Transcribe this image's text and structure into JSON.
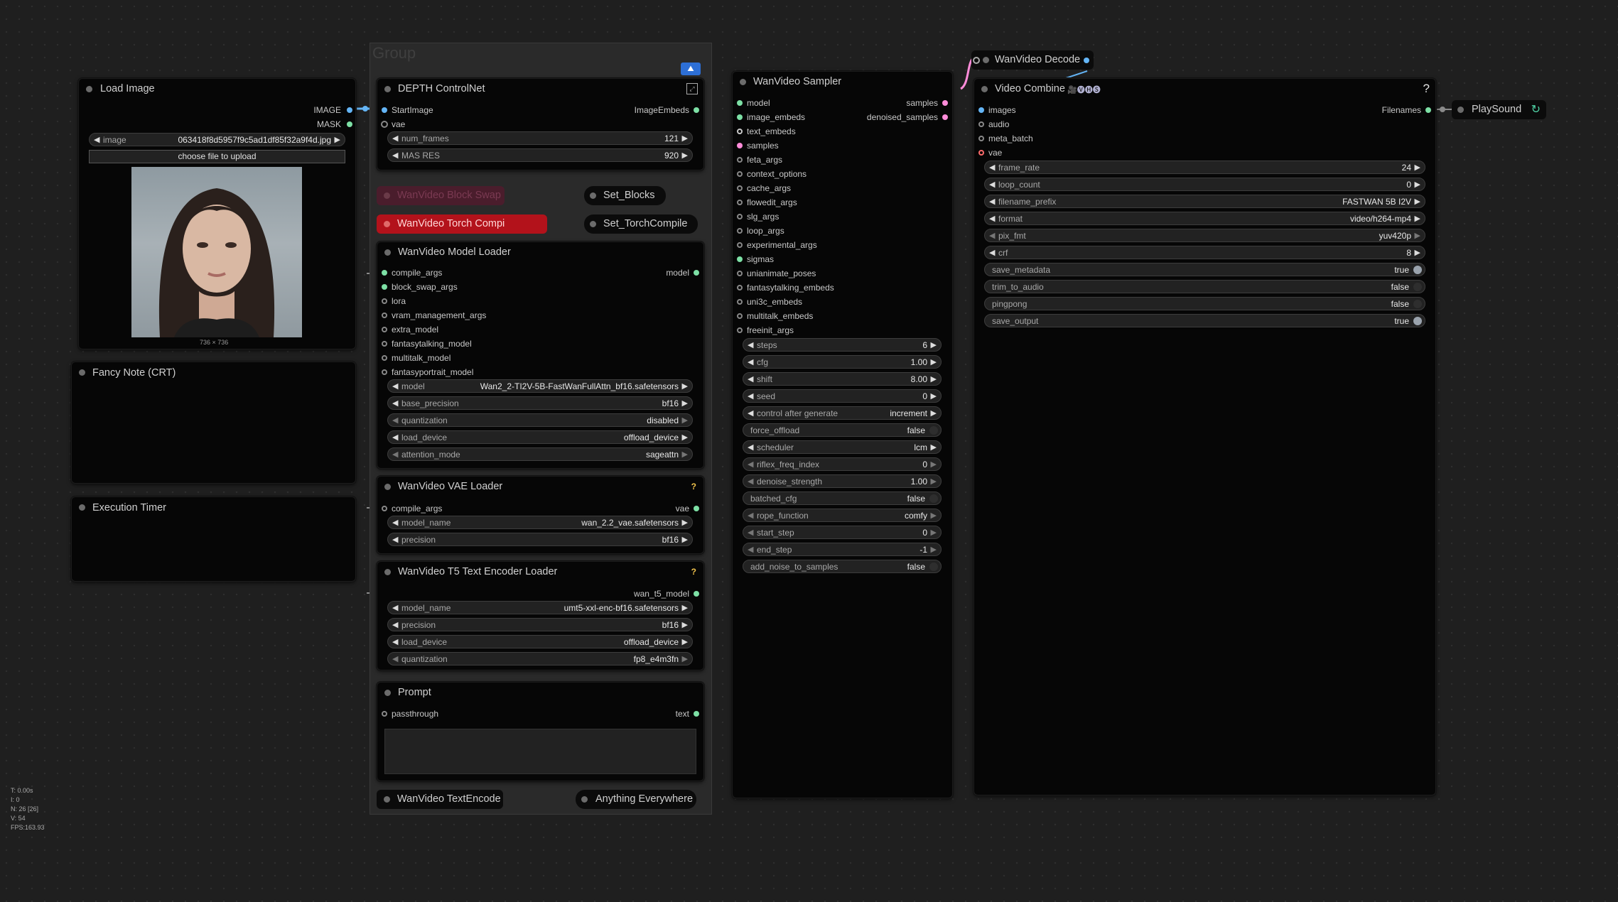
{
  "group": {
    "title": "Group"
  },
  "load_image": {
    "title": "Load Image",
    "outputs": [
      "IMAGE",
      "MASK"
    ],
    "image_widget": {
      "name": "image",
      "value": "063418f8d5957f9c5ad1df85f32a9f4d.jpg"
    },
    "upload_button": "choose file to upload",
    "dimensions": "736 × 736"
  },
  "fancy_note": {
    "title": "Fancy Note (CRT)"
  },
  "execution_timer": {
    "title": "Execution Timer"
  },
  "depth_controlnet": {
    "title": "DEPTH ControlNet",
    "inputs": [
      "StartImage",
      "vae"
    ],
    "output": "ImageEmbeds",
    "widgets": [
      {
        "name": "num_frames",
        "value": "121"
      },
      {
        "name": "MAS RES",
        "value": "920"
      }
    ]
  },
  "block_swap": {
    "title": "WanVideo Block Swap",
    "set_label": "Set_Blocks"
  },
  "torch_compile": {
    "title": "WanVideo Torch Compi",
    "set_label": "Set_TorchCompile"
  },
  "model_loader": {
    "title": "WanVideo Model Loader",
    "inputs": [
      "compile_args",
      "block_swap_args",
      "lora",
      "vram_management_args",
      "extra_model",
      "fantasytalking_model",
      "multitalk_model",
      "fantasyportrait_model"
    ],
    "output": "model",
    "widgets": [
      {
        "name": "model",
        "value": "Wan2_2-TI2V-5B-FastWanFullAttn_bf16.safetensors"
      },
      {
        "name": "base_precision",
        "value": "bf16"
      },
      {
        "name": "quantization",
        "value": "disabled"
      },
      {
        "name": "load_device",
        "value": "offload_device"
      },
      {
        "name": "attention_mode",
        "value": "sageattn"
      }
    ]
  },
  "vae_loader": {
    "title": "WanVideo VAE Loader",
    "help": "?",
    "input": "compile_args",
    "output": "vae",
    "widgets": [
      {
        "name": "model_name",
        "value": "wan_2.2_vae.safetensors"
      },
      {
        "name": "precision",
        "value": "bf16"
      }
    ]
  },
  "t5_loader": {
    "title": "WanVideo T5 Text Encoder Loader",
    "help": "?",
    "output": "wan_t5_model",
    "widgets": [
      {
        "name": "model_name",
        "value": "umt5-xxl-enc-bf16.safetensors"
      },
      {
        "name": "precision",
        "value": "bf16"
      },
      {
        "name": "load_device",
        "value": "offload_device"
      },
      {
        "name": "quantization",
        "value": "fp8_e4m3fn"
      }
    ]
  },
  "prompt": {
    "title": "Prompt",
    "input": "passthrough",
    "output": "text",
    "text": ""
  },
  "text_encode": {
    "title": "WanVideo TextEncode",
    "anything": "Anything Everywhere"
  },
  "sampler": {
    "title": "WanVideo Sampler",
    "inputs": [
      "model",
      "image_embeds",
      "text_embeds",
      "samples",
      "feta_args",
      "context_options",
      "cache_args",
      "flowedit_args",
      "slg_args",
      "loop_args",
      "experimental_args",
      "sigmas",
      "unianimate_poses",
      "fantasytalking_embeds",
      "uni3c_embeds",
      "multitalk_embeds",
      "freeinit_args"
    ],
    "outputs": [
      "samples",
      "denoised_samples"
    ],
    "widgets": [
      {
        "name": "steps",
        "value": "6"
      },
      {
        "name": "cfg",
        "value": "1.00"
      },
      {
        "name": "shift",
        "value": "8.00"
      },
      {
        "name": "seed",
        "value": "0"
      },
      {
        "name": "control after generate",
        "value": "increment"
      },
      {
        "name": "force_offload",
        "value": "false"
      },
      {
        "name": "scheduler",
        "value": "lcm"
      },
      {
        "name": "riflex_freq_index",
        "value": "0"
      },
      {
        "name": "denoise_strength",
        "value": "1.00"
      },
      {
        "name": "batched_cfg",
        "value": "false"
      },
      {
        "name": "rope_function",
        "value": "comfy"
      },
      {
        "name": "start_step",
        "value": "0"
      },
      {
        "name": "end_step",
        "value": "-1"
      },
      {
        "name": "add_noise_to_samples",
        "value": "false"
      }
    ]
  },
  "decode": {
    "title": "WanVideo Decode"
  },
  "video_combine": {
    "title": "Video Combine",
    "title_icons": "🎥🅥🅗🅢",
    "help": "?",
    "inputs": [
      "images",
      "audio",
      "meta_batch",
      "vae"
    ],
    "output": "Filenames",
    "widgets": [
      {
        "name": "frame_rate",
        "value": "24"
      },
      {
        "name": "loop_count",
        "value": "0"
      },
      {
        "name": "filename_prefix",
        "value": "FASTWAN 5B I2V"
      },
      {
        "name": "format",
        "value": "video/h264-mp4"
      },
      {
        "name": "pix_fmt",
        "value": "yuv420p"
      },
      {
        "name": "crf",
        "value": "8"
      },
      {
        "name": "save_metadata",
        "value": "true"
      },
      {
        "name": "trim_to_audio",
        "value": "false"
      },
      {
        "name": "pingpong",
        "value": "false"
      },
      {
        "name": "save_output",
        "value": "true"
      }
    ]
  },
  "play_sound": {
    "title": "PlaySound"
  },
  "stats": {
    "lines": [
      "T: 0.00s",
      "I: 0",
      "N: 26 [26]",
      "V: 54",
      "FPS:163.93"
    ]
  },
  "colors": {
    "canvas": "#1f1f1f",
    "node_bg": "#060606",
    "widget_bg": "#222222",
    "torch_red": "#b3121b",
    "block_swap_muted": "#4a1d2c",
    "vae_socket": "#ff6b6b",
    "image_socket": "#64b5f6",
    "latent_socket": "#ff8cd9",
    "accent_blue": "#2d6fd6"
  }
}
